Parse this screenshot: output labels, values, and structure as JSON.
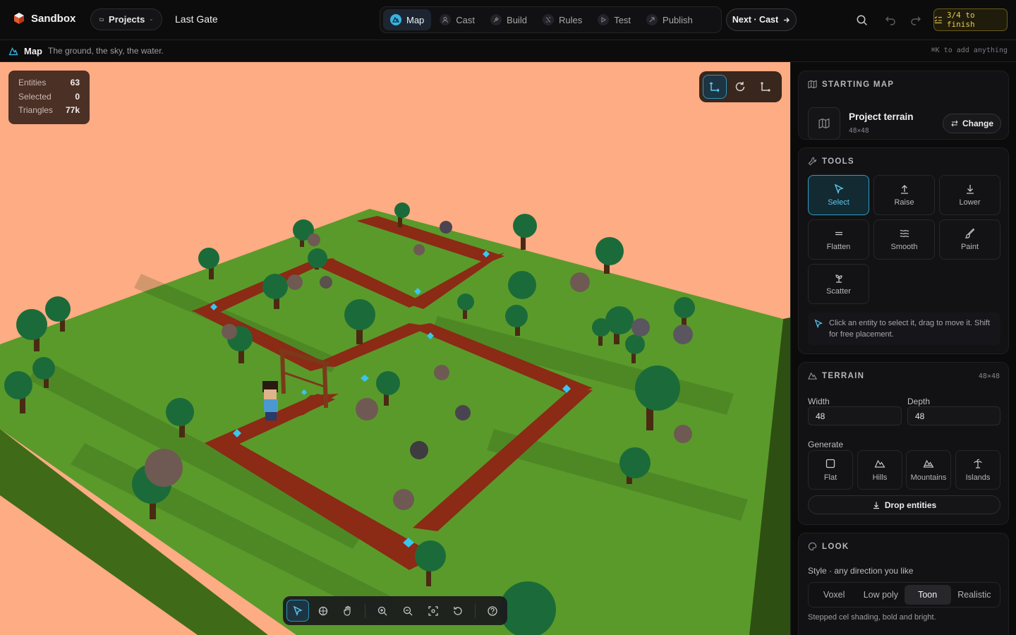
{
  "app": {
    "name": "Sandbox",
    "projects_label": "Projects",
    "project_name": "Last Gate"
  },
  "steps": [
    {
      "label": "Map",
      "icon": "map-icon",
      "active": true
    },
    {
      "label": "Cast",
      "icon": "cast-icon",
      "active": false
    },
    {
      "label": "Build",
      "icon": "build-icon",
      "active": false
    },
    {
      "label": "Rules",
      "icon": "rules-icon",
      "active": false
    },
    {
      "label": "Test",
      "icon": "play-icon",
      "active": false
    },
    {
      "label": "Publish",
      "icon": "publish-icon",
      "active": false
    }
  ],
  "next_button": "Next · Cast",
  "progress": {
    "label": "3/4 to finish",
    "done": 3,
    "total": 4
  },
  "subbar": {
    "title": "Map",
    "description": "The ground, the sky, the water.",
    "shortcut_hint": "⌘K to add anything"
  },
  "stats": [
    {
      "label": "Entities",
      "value": "63"
    },
    {
      "label": "Selected",
      "value": "0"
    },
    {
      "label": "Triangles",
      "value": "77k"
    }
  ],
  "starting_map": {
    "heading": "STARTING MAP",
    "name": "Project terrain",
    "size": "48×48",
    "change_label": "Change"
  },
  "tools": {
    "heading": "TOOLS",
    "items": [
      {
        "label": "Select",
        "icon": "pointer-icon",
        "active": true
      },
      {
        "label": "Raise",
        "icon": "raise-icon",
        "active": false
      },
      {
        "label": "Lower",
        "icon": "lower-icon",
        "active": false
      },
      {
        "label": "Flatten",
        "icon": "flatten-icon",
        "active": false
      },
      {
        "label": "Smooth",
        "icon": "smooth-icon",
        "active": false
      },
      {
        "label": "Paint",
        "icon": "brush-icon",
        "active": false
      },
      {
        "label": "Scatter",
        "icon": "scatter-icon",
        "active": false
      }
    ],
    "tip": "Click an entity to select it, drag to move it. Shift for free placement."
  },
  "terrain": {
    "heading": "TERRAIN",
    "size": "48×48",
    "width_label": "Width",
    "width_value": "48",
    "depth_label": "Depth",
    "depth_value": "48",
    "generate_label": "Generate",
    "generate_options": [
      {
        "label": "Flat",
        "icon": "flat-icon"
      },
      {
        "label": "Hills",
        "icon": "hills-icon"
      },
      {
        "label": "Mountains",
        "icon": "mountains-icon"
      },
      {
        "label": "Islands",
        "icon": "islands-icon"
      }
    ],
    "drop_label": "Drop entities"
  },
  "look": {
    "heading": "LOOK",
    "style_label": "Style · any direction you like",
    "styles": [
      {
        "label": "Voxel",
        "active": false
      },
      {
        "label": "Low poly",
        "active": false
      },
      {
        "label": "Toon",
        "active": true
      },
      {
        "label": "Realistic",
        "active": false
      }
    ],
    "style_description": "Stepped cel shading, bold and bright."
  },
  "colors": {
    "sky": "#fdac84",
    "grass": "#5a9a2b",
    "path": "#8b2a15",
    "accent": "#38b4e2",
    "finish": "#e9c94c"
  }
}
